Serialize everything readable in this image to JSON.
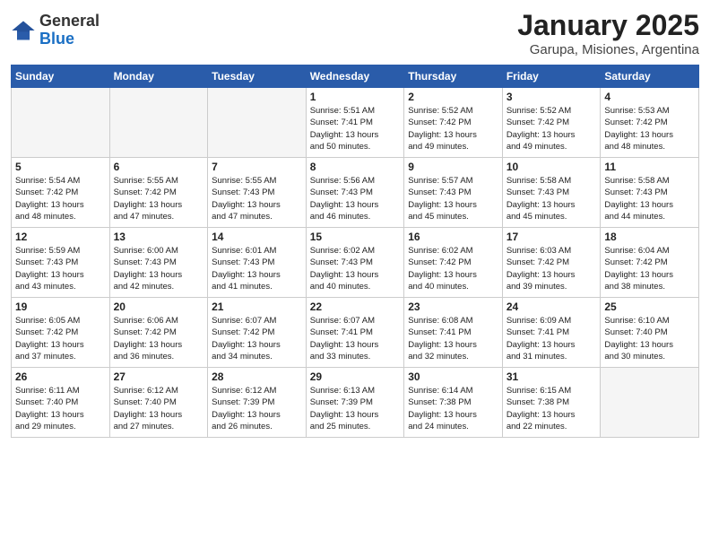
{
  "logo": {
    "general": "General",
    "blue": "Blue"
  },
  "title": "January 2025",
  "subtitle": "Garupa, Misiones, Argentina",
  "headers": [
    "Sunday",
    "Monday",
    "Tuesday",
    "Wednesday",
    "Thursday",
    "Friday",
    "Saturday"
  ],
  "weeks": [
    [
      {
        "num": "",
        "info": "",
        "empty": true
      },
      {
        "num": "",
        "info": "",
        "empty": true
      },
      {
        "num": "",
        "info": "",
        "empty": true
      },
      {
        "num": "1",
        "info": "Sunrise: 5:51 AM\nSunset: 7:41 PM\nDaylight: 13 hours\nand 50 minutes."
      },
      {
        "num": "2",
        "info": "Sunrise: 5:52 AM\nSunset: 7:42 PM\nDaylight: 13 hours\nand 49 minutes."
      },
      {
        "num": "3",
        "info": "Sunrise: 5:52 AM\nSunset: 7:42 PM\nDaylight: 13 hours\nand 49 minutes."
      },
      {
        "num": "4",
        "info": "Sunrise: 5:53 AM\nSunset: 7:42 PM\nDaylight: 13 hours\nand 48 minutes."
      }
    ],
    [
      {
        "num": "5",
        "info": "Sunrise: 5:54 AM\nSunset: 7:42 PM\nDaylight: 13 hours\nand 48 minutes."
      },
      {
        "num": "6",
        "info": "Sunrise: 5:55 AM\nSunset: 7:42 PM\nDaylight: 13 hours\nand 47 minutes."
      },
      {
        "num": "7",
        "info": "Sunrise: 5:55 AM\nSunset: 7:43 PM\nDaylight: 13 hours\nand 47 minutes."
      },
      {
        "num": "8",
        "info": "Sunrise: 5:56 AM\nSunset: 7:43 PM\nDaylight: 13 hours\nand 46 minutes."
      },
      {
        "num": "9",
        "info": "Sunrise: 5:57 AM\nSunset: 7:43 PM\nDaylight: 13 hours\nand 45 minutes."
      },
      {
        "num": "10",
        "info": "Sunrise: 5:58 AM\nSunset: 7:43 PM\nDaylight: 13 hours\nand 45 minutes."
      },
      {
        "num": "11",
        "info": "Sunrise: 5:58 AM\nSunset: 7:43 PM\nDaylight: 13 hours\nand 44 minutes."
      }
    ],
    [
      {
        "num": "12",
        "info": "Sunrise: 5:59 AM\nSunset: 7:43 PM\nDaylight: 13 hours\nand 43 minutes."
      },
      {
        "num": "13",
        "info": "Sunrise: 6:00 AM\nSunset: 7:43 PM\nDaylight: 13 hours\nand 42 minutes."
      },
      {
        "num": "14",
        "info": "Sunrise: 6:01 AM\nSunset: 7:43 PM\nDaylight: 13 hours\nand 41 minutes."
      },
      {
        "num": "15",
        "info": "Sunrise: 6:02 AM\nSunset: 7:43 PM\nDaylight: 13 hours\nand 40 minutes."
      },
      {
        "num": "16",
        "info": "Sunrise: 6:02 AM\nSunset: 7:42 PM\nDaylight: 13 hours\nand 40 minutes."
      },
      {
        "num": "17",
        "info": "Sunrise: 6:03 AM\nSunset: 7:42 PM\nDaylight: 13 hours\nand 39 minutes."
      },
      {
        "num": "18",
        "info": "Sunrise: 6:04 AM\nSunset: 7:42 PM\nDaylight: 13 hours\nand 38 minutes."
      }
    ],
    [
      {
        "num": "19",
        "info": "Sunrise: 6:05 AM\nSunset: 7:42 PM\nDaylight: 13 hours\nand 37 minutes."
      },
      {
        "num": "20",
        "info": "Sunrise: 6:06 AM\nSunset: 7:42 PM\nDaylight: 13 hours\nand 36 minutes."
      },
      {
        "num": "21",
        "info": "Sunrise: 6:07 AM\nSunset: 7:42 PM\nDaylight: 13 hours\nand 34 minutes."
      },
      {
        "num": "22",
        "info": "Sunrise: 6:07 AM\nSunset: 7:41 PM\nDaylight: 13 hours\nand 33 minutes."
      },
      {
        "num": "23",
        "info": "Sunrise: 6:08 AM\nSunset: 7:41 PM\nDaylight: 13 hours\nand 32 minutes."
      },
      {
        "num": "24",
        "info": "Sunrise: 6:09 AM\nSunset: 7:41 PM\nDaylight: 13 hours\nand 31 minutes."
      },
      {
        "num": "25",
        "info": "Sunrise: 6:10 AM\nSunset: 7:40 PM\nDaylight: 13 hours\nand 30 minutes."
      }
    ],
    [
      {
        "num": "26",
        "info": "Sunrise: 6:11 AM\nSunset: 7:40 PM\nDaylight: 13 hours\nand 29 minutes."
      },
      {
        "num": "27",
        "info": "Sunrise: 6:12 AM\nSunset: 7:40 PM\nDaylight: 13 hours\nand 27 minutes."
      },
      {
        "num": "28",
        "info": "Sunrise: 6:12 AM\nSunset: 7:39 PM\nDaylight: 13 hours\nand 26 minutes."
      },
      {
        "num": "29",
        "info": "Sunrise: 6:13 AM\nSunset: 7:39 PM\nDaylight: 13 hours\nand 25 minutes."
      },
      {
        "num": "30",
        "info": "Sunrise: 6:14 AM\nSunset: 7:38 PM\nDaylight: 13 hours\nand 24 minutes."
      },
      {
        "num": "31",
        "info": "Sunrise: 6:15 AM\nSunset: 7:38 PM\nDaylight: 13 hours\nand 22 minutes."
      },
      {
        "num": "",
        "info": "",
        "empty": true
      }
    ]
  ]
}
